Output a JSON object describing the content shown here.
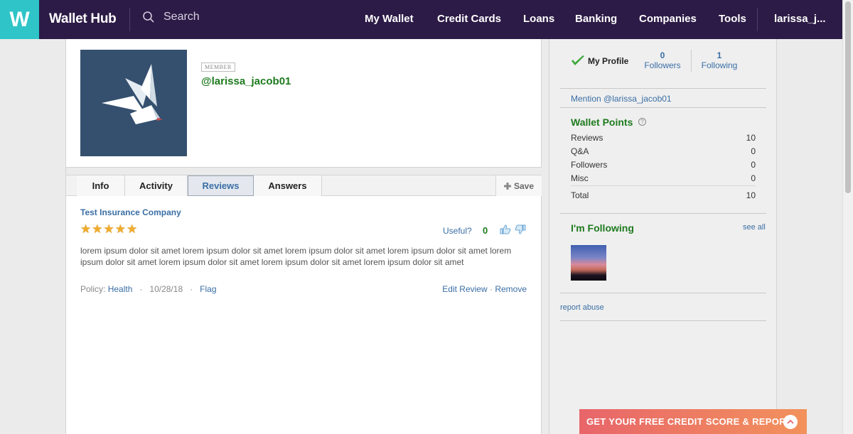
{
  "header": {
    "logo_letter": "W",
    "brand": "Wallet Hub",
    "search_placeholder": "Search",
    "nav": [
      "My Wallet",
      "Credit Cards",
      "Loans",
      "Banking",
      "Companies",
      "Tools"
    ],
    "user": "larissa_j..."
  },
  "profile": {
    "badge": "MEMBER",
    "username": "@larissa_jacob01"
  },
  "tabs": [
    "Info",
    "Activity",
    "Reviews",
    "Answers"
  ],
  "active_tab": "Reviews",
  "save_label": "Save",
  "review": {
    "company": "Test Insurance Company",
    "rating": 5,
    "useful_label": "Useful?",
    "useful_count": "0",
    "text": "lorem ipsum dolor sit amet lorem ipsum dolor sit amet lorem ipsum dolor sit amet lorem ipsum dolor sit amet lorem ipsum dolor sit amet lorem ipsum dolor sit amet lorem ipsum dolor sit amet lorem ipsum dolor sit amet",
    "policy_label": "Policy:",
    "policy_value": "Health",
    "date": "10/28/18",
    "flag": "Flag",
    "edit": "Edit Review",
    "remove": "Remove",
    "sep": "·"
  },
  "sidebar": {
    "my_profile": "My Profile",
    "followers_count": "0",
    "followers_label": "Followers",
    "following_count": "1",
    "following_label": "Following",
    "mention": "Mention @larissa_jacob01",
    "wallet_points_title": "Wallet Points",
    "points": [
      {
        "label": "Reviews",
        "value": "10"
      },
      {
        "label": "Q&A",
        "value": "0"
      },
      {
        "label": "Followers",
        "value": "0"
      },
      {
        "label": "Misc",
        "value": "0"
      }
    ],
    "total_label": "Total",
    "total_value": "10",
    "following_title": "I'm Following",
    "see_all": "see all",
    "report_abuse": "report abuse"
  },
  "cta": {
    "label": "GET YOUR FREE CREDIT SCORE & REPORT"
  },
  "colors": {
    "header_bg": "#2c1b46",
    "logo_bg": "#2ec4c8",
    "green": "#1e7a1e",
    "link_blue": "#3a6ea5",
    "star": "#f0ac2c",
    "cta_from": "#e8656a",
    "cta_to": "#f2925c"
  },
  "icons": [
    "search-icon",
    "plus-icon",
    "thumbs-up-icon",
    "thumbs-down-icon",
    "checkmark-icon",
    "help-icon",
    "chevron-up-icon"
  ]
}
